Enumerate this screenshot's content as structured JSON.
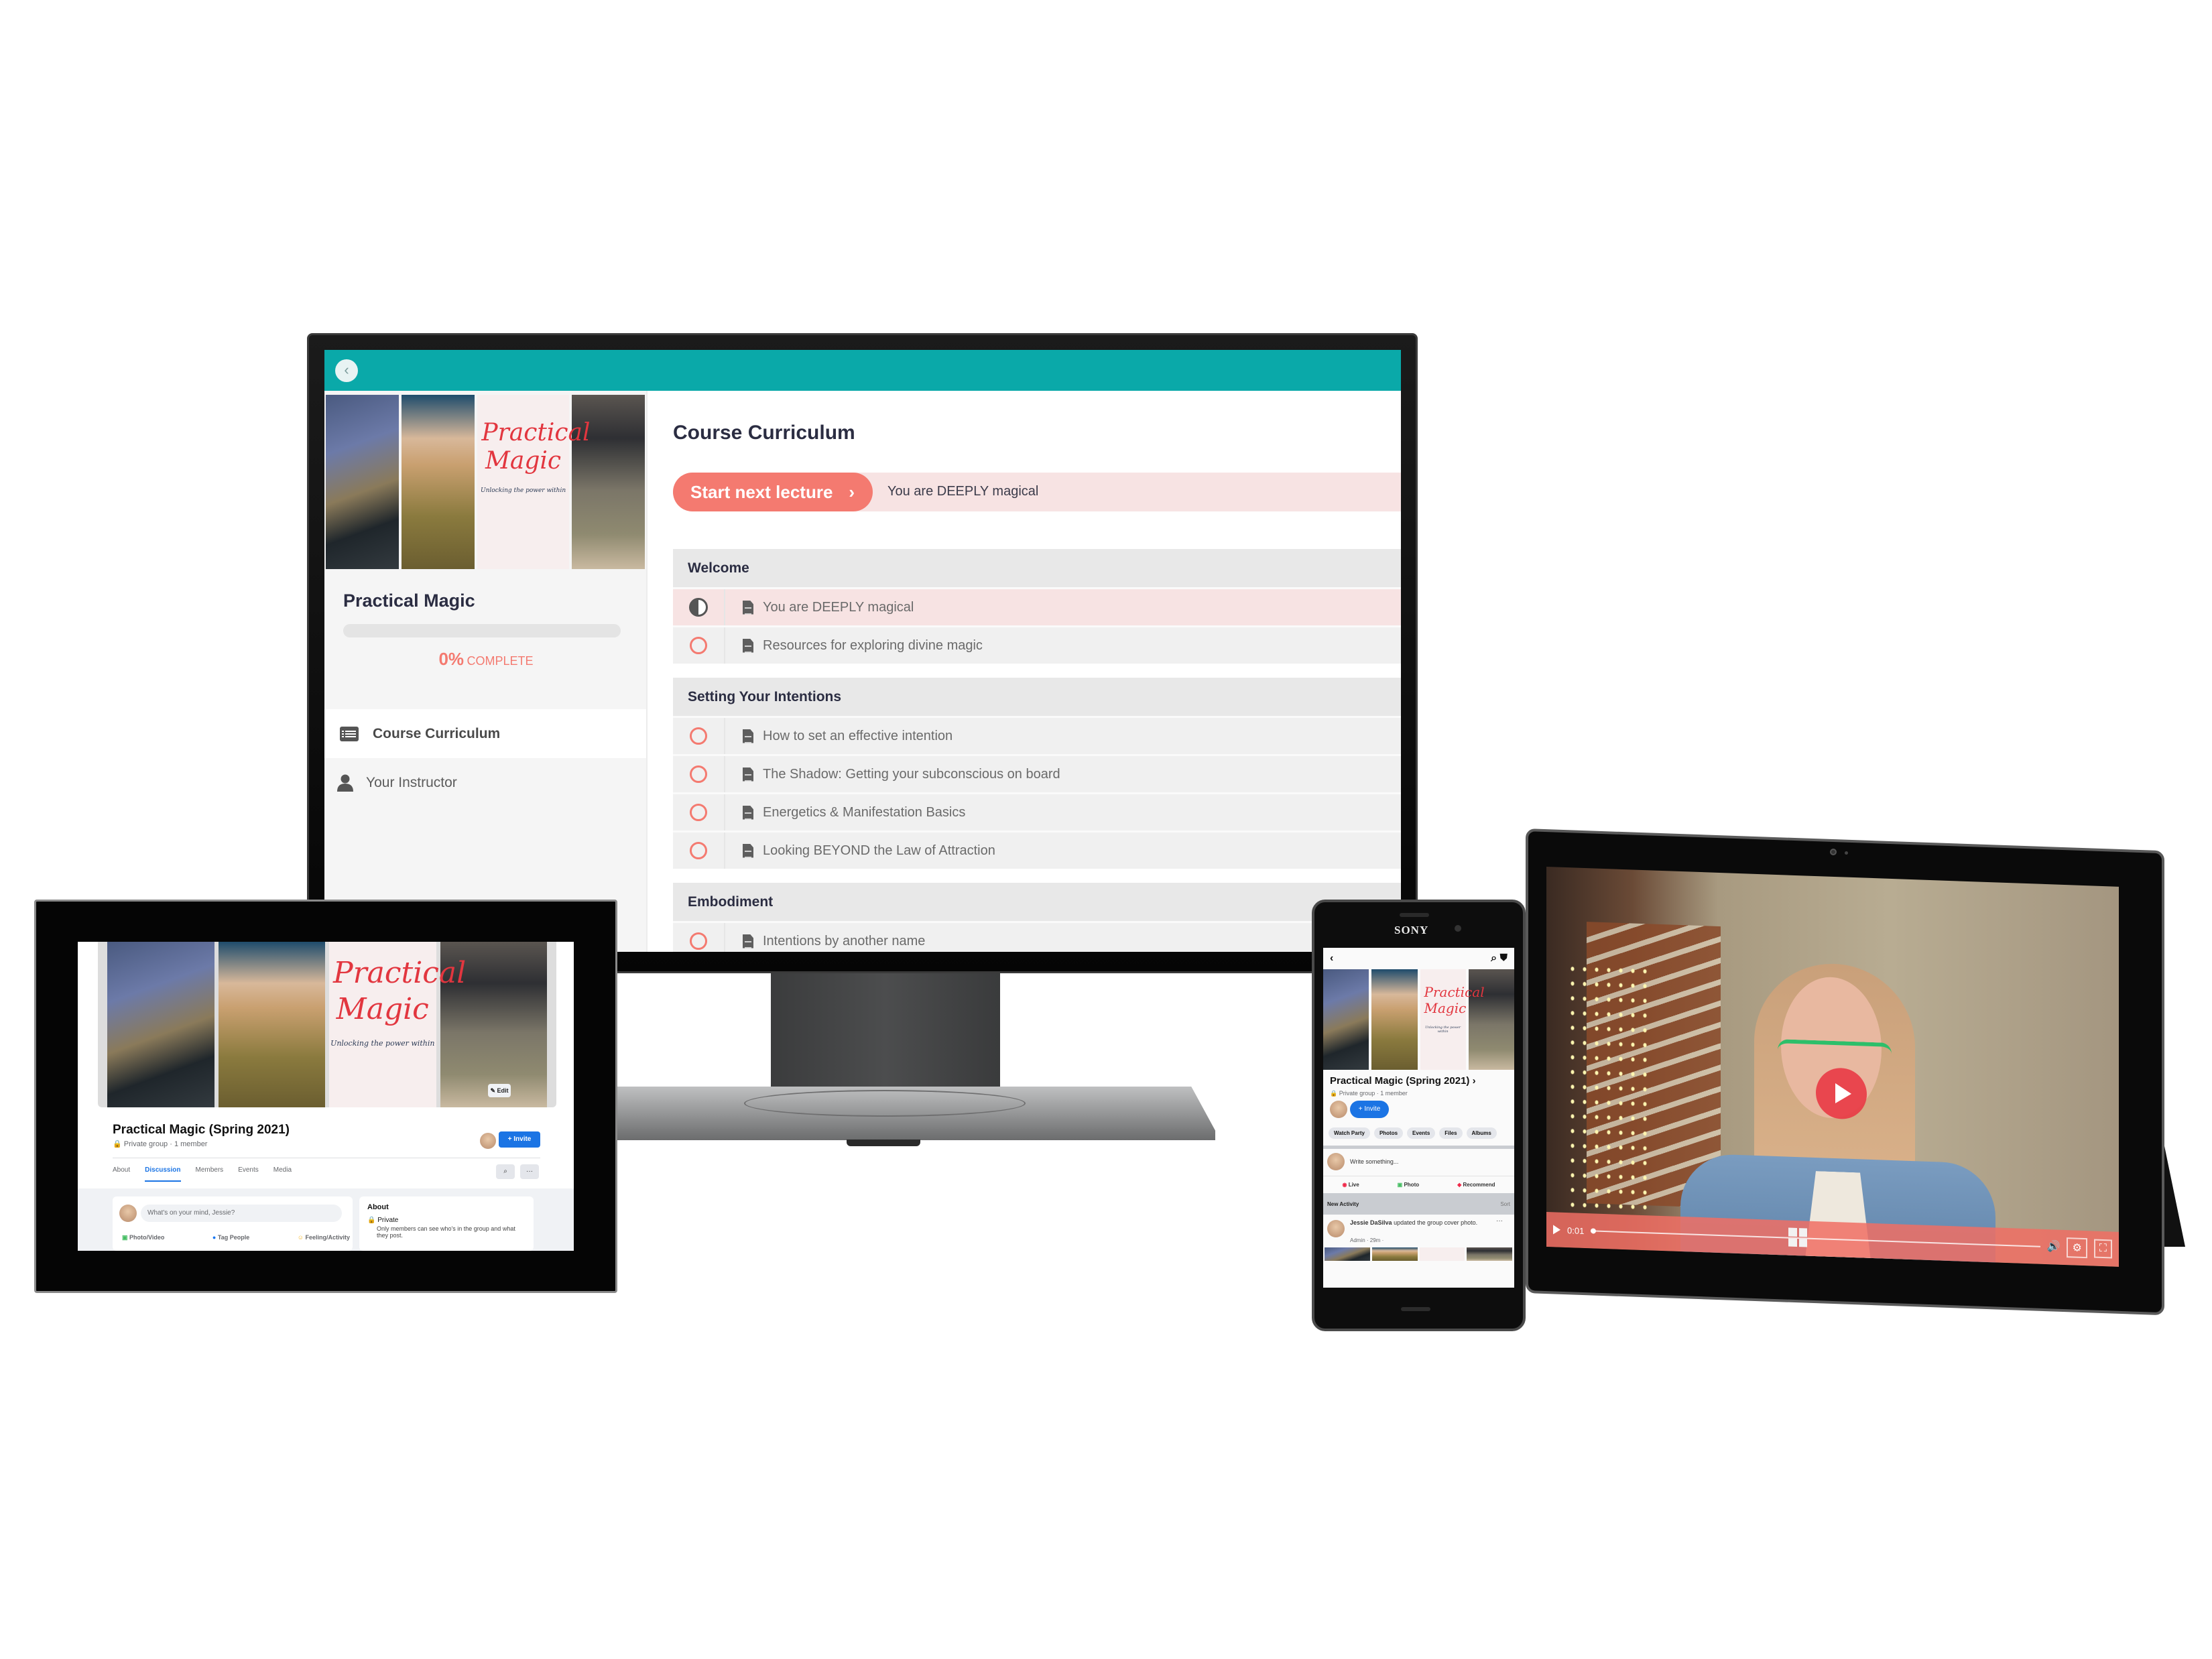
{
  "monitor": {
    "lms": {
      "back_icon": "‹",
      "course": {
        "title": "Practical Magic",
        "banner_script": "Practical Magic",
        "banner_subtitle": "Unlocking the power within",
        "progress_percent": 0,
        "progress_pct_label": "0%",
        "progress_word": "COMPLETE"
      },
      "sidebar_nav": [
        {
          "label": "Course Curriculum",
          "icon": "list-icon",
          "active": true
        },
        {
          "label": "Your Instructor",
          "icon": "user-icon",
          "active": false
        }
      ],
      "main": {
        "title": "Course Curriculum",
        "next_button_label": "Start next lecture",
        "next_button_chevron": "›",
        "next_lecture_title": "You are DEEPLY magical"
      },
      "sections": [
        {
          "title": "Welcome",
          "lectures": [
            {
              "title": "You are DEEPLY magical",
              "status": "in-progress"
            },
            {
              "title": "Resources for exploring divine magic",
              "status": "not-started"
            }
          ]
        },
        {
          "title": "Setting Your Intentions",
          "lectures": [
            {
              "title": "How to set an effective intention",
              "status": "not-started"
            },
            {
              "title": "The Shadow: Getting your subconscious on board",
              "status": "not-started"
            },
            {
              "title": "Energetics & Manifestation Basics",
              "status": "not-started"
            },
            {
              "title": "Looking BEYOND the Law of Attraction",
              "status": "not-started"
            }
          ]
        },
        {
          "title": "Embodiment",
          "lectures": [
            {
              "title": "Intentions by another name",
              "status": "not-started"
            }
          ]
        }
      ]
    }
  },
  "tablet": {
    "group_name": "Practical Magic (Spring 2021)",
    "group_meta": "🔒 Private group · 1 member",
    "edit_label": "✎ Edit",
    "invite_label": "+ Invite",
    "tabs": [
      {
        "label": "About",
        "active": false
      },
      {
        "label": "Discussion",
        "active": true
      },
      {
        "label": "Members",
        "active": false
      },
      {
        "label": "Events",
        "active": false
      },
      {
        "label": "Media",
        "active": false
      }
    ],
    "search_icon": "⌕",
    "more_icon": "···",
    "composer": {
      "placeholder": "What's on your mind, Jessie?",
      "actions": [
        "Photo/Video",
        "Tag People",
        "Feeling/Activity"
      ]
    },
    "about": {
      "heading": "About",
      "privacy": "🔒 Private",
      "privacy_desc": "Only members can see who's in the group and what they post."
    }
  },
  "phone": {
    "brand": "SONY",
    "back_icon": "‹",
    "search_icon": "⌕",
    "shield_icon": "⛊",
    "group_name": "Practical Magic (Spring 2021) ›",
    "group_meta": "🔒 Private group · 1 member",
    "invite_label": "+ Invite",
    "chips": [
      "Watch Party",
      "Photos",
      "Events",
      "Files",
      "Albums"
    ],
    "composer_placeholder": "Write something...",
    "actions": [
      "Live",
      "Photo",
      "Recommend"
    ],
    "activity_title": "New Activity",
    "sort_label": "Sort",
    "post": {
      "author": "Jessie DaSilva",
      "text": "updated the group cover photo.",
      "meta": "Admin · 29m ·",
      "more_icon": "···"
    }
  },
  "surface": {
    "video": {
      "current_time": "0:01",
      "progress_fraction": 0.0,
      "volume_icon": "🔊",
      "settings_icon": "⚙",
      "fullscreen_icon": "⛶"
    }
  },
  "colors": {
    "teal_header": "#0aa9a9",
    "accent_coral": "#f47a70",
    "active_row": "#f7e3e3",
    "fb_blue": "#1b74e4"
  }
}
